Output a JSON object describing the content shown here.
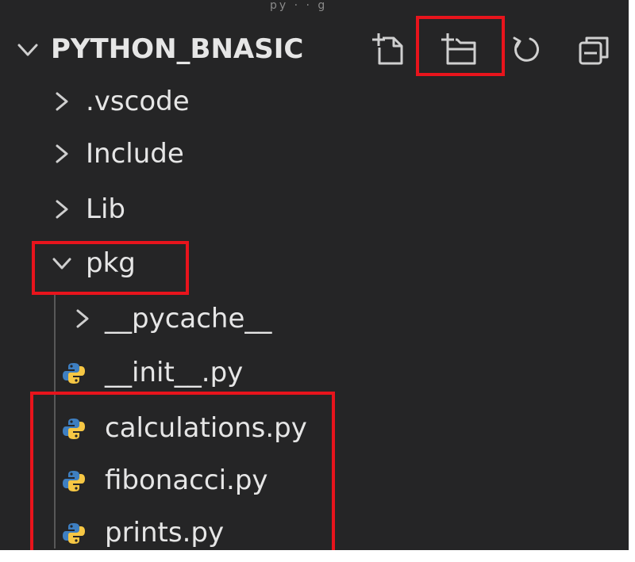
{
  "window": {
    "top_fragment": "py · · g"
  },
  "explorer": {
    "folder_name": "PYTHON_BNASIC",
    "toolbar": {
      "new_file_icon": "new-file-icon",
      "new_folder_icon": "new-folder-icon",
      "refresh_icon": "refresh-icon",
      "collapse_all_icon": "collapse-all-icon"
    },
    "items": [
      {
        "label": ".vscode",
        "kind": "folder",
        "expanded": false,
        "depth": 0
      },
      {
        "label": "Include",
        "kind": "folder",
        "expanded": false,
        "depth": 0
      },
      {
        "label": "Lib",
        "kind": "folder",
        "expanded": false,
        "depth": 0
      },
      {
        "label": "pkg",
        "kind": "folder",
        "expanded": true,
        "depth": 0
      },
      {
        "label": "__pycache__",
        "kind": "folder",
        "expanded": false,
        "depth": 1
      },
      {
        "label": "__init__.py",
        "kind": "python-file",
        "depth": 1
      },
      {
        "label": "calculations.py",
        "kind": "python-file",
        "depth": 1
      },
      {
        "label": "fibonacci.py",
        "kind": "python-file",
        "depth": 1
      },
      {
        "label": "prints.py",
        "kind": "python-file",
        "depth": 1
      }
    ]
  },
  "colors": {
    "background": "#252526",
    "text": "#e6e6e6",
    "highlight": "#e8141c",
    "python_blue": "#3e7fc1",
    "python_yellow": "#f6c744"
  }
}
